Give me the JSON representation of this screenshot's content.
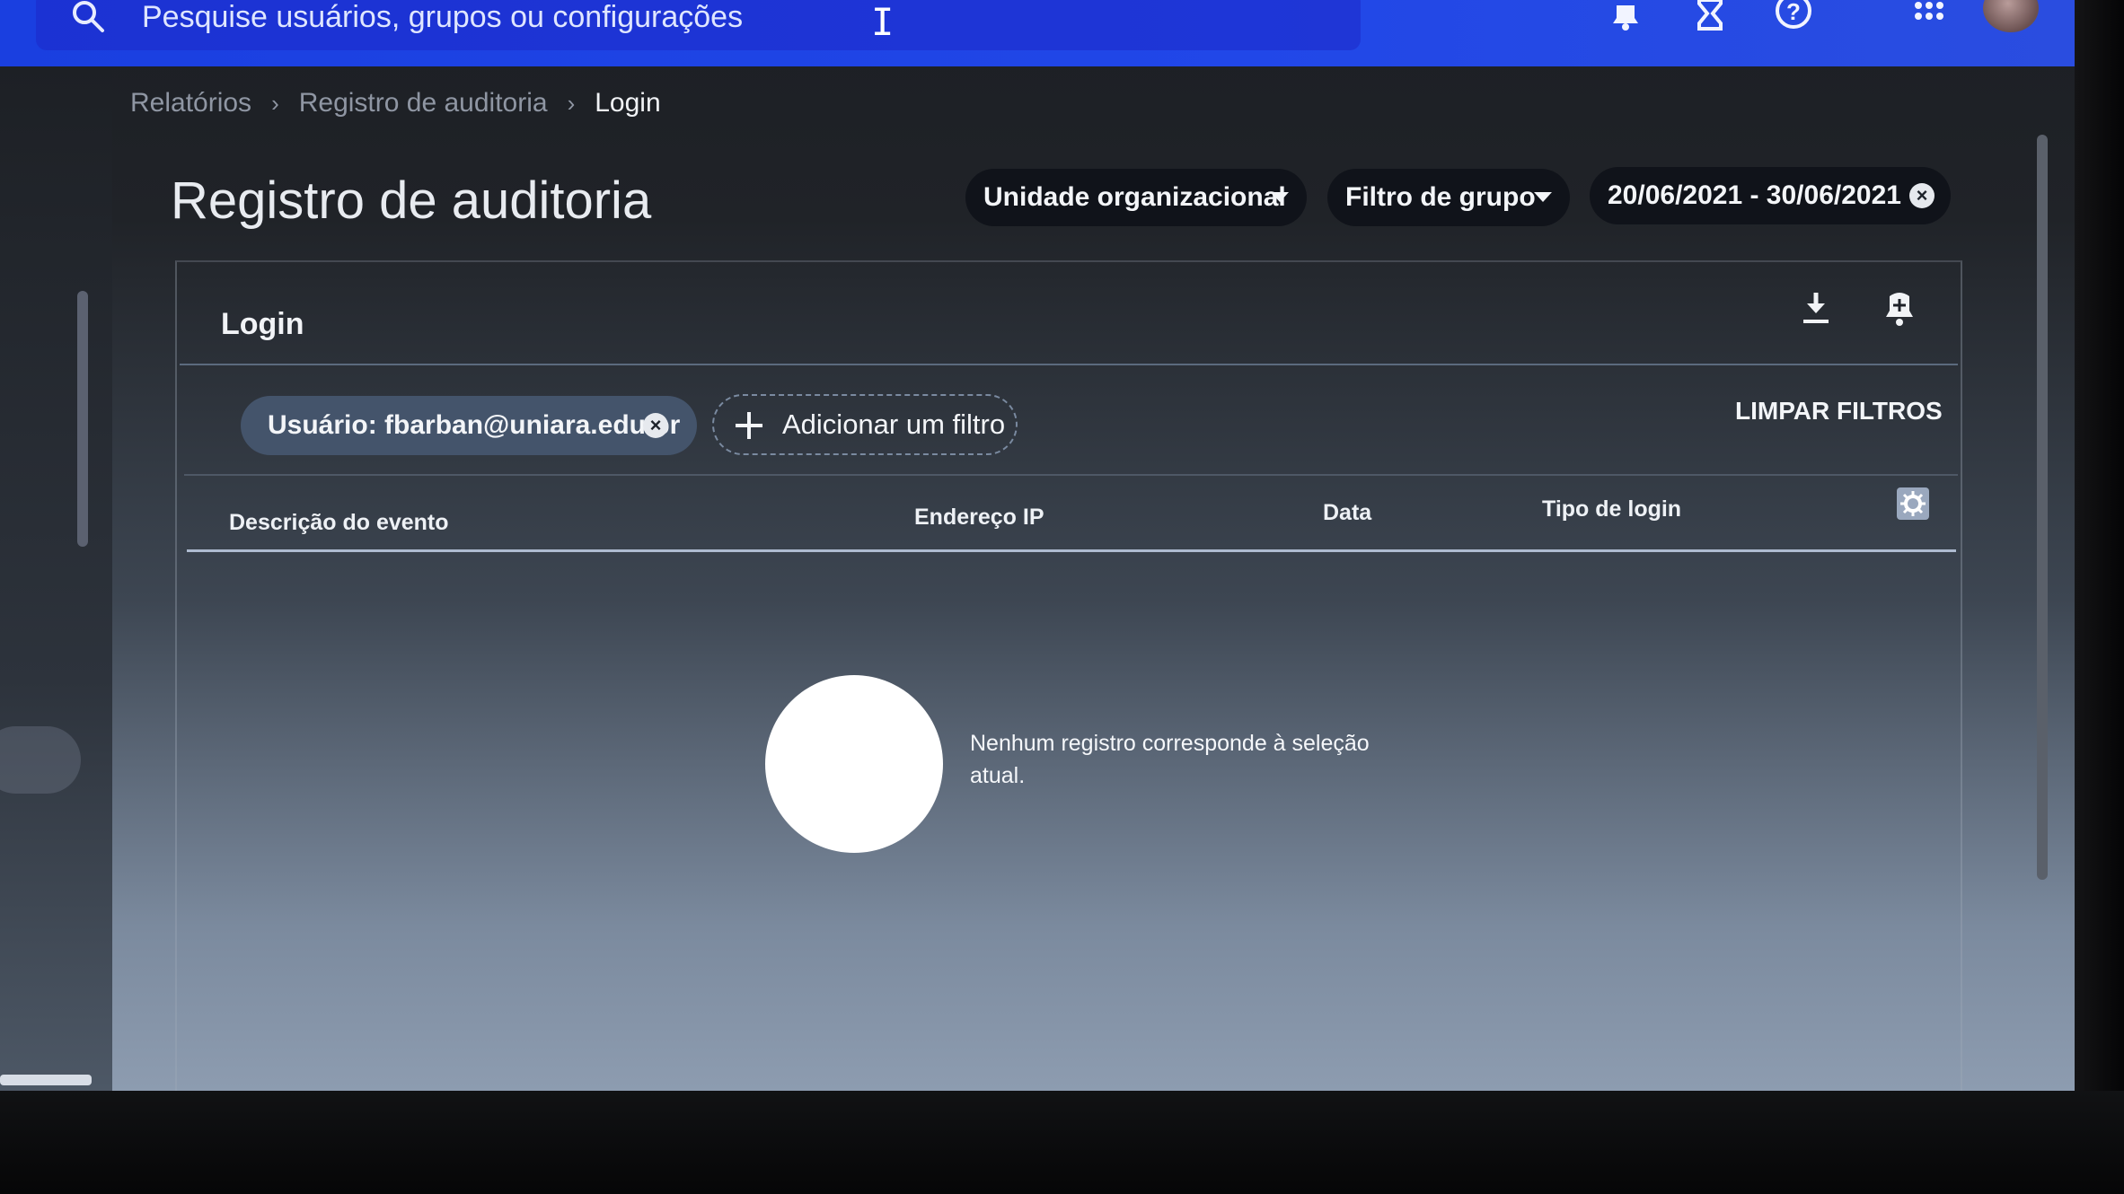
{
  "search": {
    "placeholder": "Pesquise usuários, grupos ou configurações"
  },
  "topbar_icons": [
    "bell-icon",
    "hourglass-icon",
    "help-icon",
    "apps-grid-icon"
  ],
  "breadcrumb": {
    "items": [
      "Relatórios",
      "Registro de auditoria"
    ],
    "current": "Login",
    "separator": "›"
  },
  "page": {
    "title": "Registro de auditoria"
  },
  "filters": {
    "org_unit": "Unidade organizacional",
    "group_filter": "Filtro de grupo",
    "date_range": "20/06/2021 - 30/06/2021"
  },
  "panel": {
    "title": "Login",
    "user_chip": "Usuário: fbarban@uniara.edu.br",
    "add_filter": "Adicionar um filtro",
    "clear_filters": "LIMPAR FILTROS"
  },
  "table": {
    "columns": [
      "Descrição do evento",
      "Endereço IP",
      "Data",
      "Tipo de login"
    ],
    "empty_message": "Nenhum registro corresponde à seleção atual."
  },
  "colors": {
    "topbar": "#2147e8",
    "chip_user": "#44546b",
    "chip_dark": "#10131a"
  }
}
